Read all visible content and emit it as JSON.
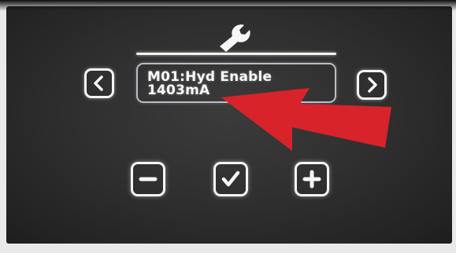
{
  "header": {
    "icon": "wrench-icon"
  },
  "navigation": {
    "prev_icon": "chevron-left-icon",
    "next_icon": "chevron-right-icon"
  },
  "display": {
    "line1": "M01:Hyd Enable",
    "line2": "1403mA"
  },
  "controls": {
    "minus_icon": "minus-icon",
    "confirm_icon": "check-icon",
    "plus_icon": "plus-icon"
  },
  "annotation": {
    "arrow_color": "#d8232a"
  },
  "colors": {
    "screen_background": "#303030",
    "foreground": "#f4f4f4",
    "value_box_border": "#b9bec6"
  }
}
